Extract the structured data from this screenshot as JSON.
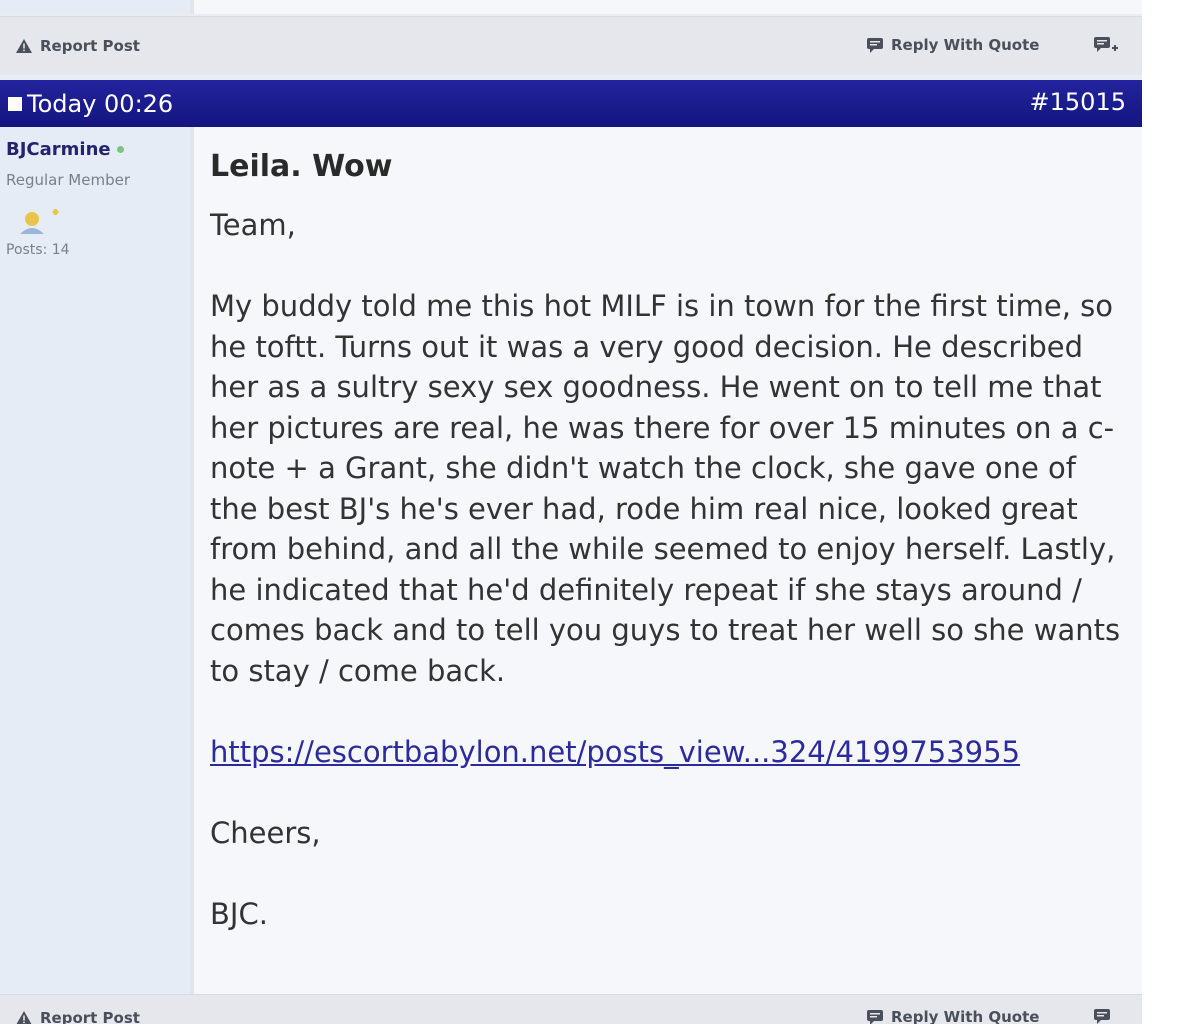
{
  "previous_post_footer": {
    "report_label": "Report Post",
    "reply_quote_label": "Reply With Quote"
  },
  "post": {
    "date": "Today 00:26",
    "number": "#15015",
    "author": {
      "username": "BJCarmine",
      "title": "Regular Member",
      "posts": "Posts: 14",
      "status_color": "#7cc47c"
    },
    "title": "Leila. Wow",
    "greeting": "Team,",
    "body": "My buddy told me this hot MILF is in town for the first time, so he toftt. Turns out it was a very good decision. He described her as a sultry sexy sex goodness. He went on to tell me that her pictures are real, he was there for over 15 minutes on a c-note + a Grant, she didn't watch the clock, she gave one of the best BJ's he's ever had, rode him real nice, looked great from behind, and all the while seemed to enjoy herself. Lastly, he indicated that he'd definitely repeat if she stays around / comes back and to tell you guys to treat her well so she wants to stay / come back.",
    "link": "https://escortbabylon.net/posts_view...324/4199753955",
    "signoff": "Cheers,",
    "signature": "BJC."
  },
  "post_footer": {
    "report_label": "Report Post",
    "reply_quote_label": "Reply With Quote"
  },
  "colors": {
    "header_bg": "#1a1b8f",
    "link": "#2b2b9e"
  },
  "icons": {
    "report": "warning-triangle-icon",
    "reply_quote": "speech-bubble-icon",
    "multi_quote": "multi-quote-icon",
    "post_marker": "square-icon",
    "reputation": "reputation-badge-icon"
  }
}
